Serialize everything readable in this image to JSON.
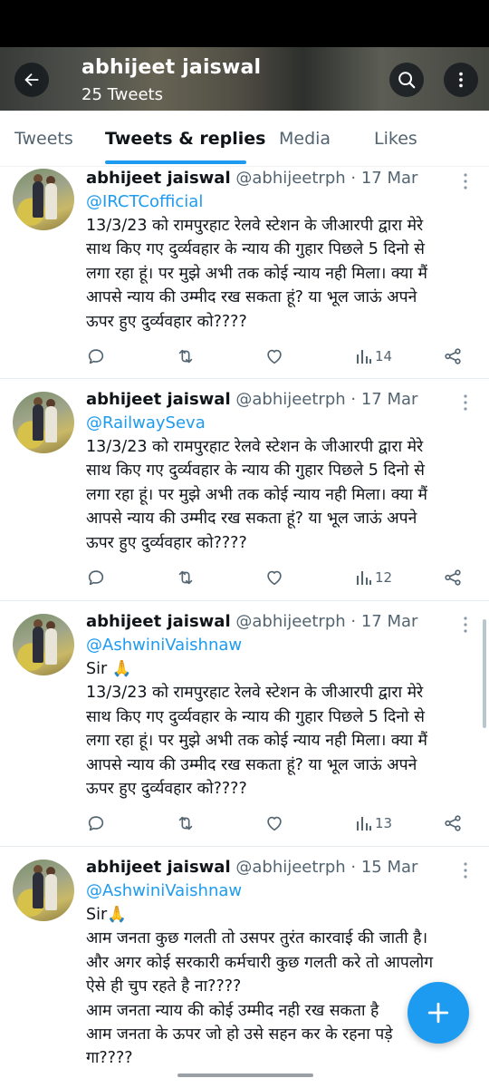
{
  "header": {
    "title": "abhijeet jaiswal",
    "subtitle": "25 Tweets",
    "back_icon": "arrow-left-icon",
    "search_icon": "search-icon",
    "more_icon": "more-vertical-icon"
  },
  "tabs": [
    {
      "label": "Tweets",
      "active": false
    },
    {
      "label": "Tweets & replies",
      "active": true
    },
    {
      "label": "Media",
      "active": false
    },
    {
      "label": "Likes",
      "active": false
    }
  ],
  "tweets": [
    {
      "name": "abhijeet jaiswal",
      "handle": "@abhijeetrph · 17 Mar",
      "mention": "@IRCTCofficial",
      "text": "13/3/23 को रामपुरहाट रेलवे स्टेशन के जीआरपी द्वारा मेरे\nसाथ किए गए दुर्व्यवहार के न्याय की गुहार पिछले 5 दिनो से\nलगा रहा हूं। पर मुझे अभी तक कोई न्याय नही मिला। क्या मैं\nआपसे न्याय की उम्मीद रख सकता हूं? या भूल जाऊं अपने\nऊपर हुए दुर्व्यवहार को????",
      "views": "14"
    },
    {
      "name": "abhijeet jaiswal",
      "handle": "@abhijeetrph · 17 Mar",
      "mention": "@RailwaySeva",
      "text": "13/3/23 को रामपुरहाट रेलवे स्टेशन के जीआरपी द्वारा मेरे\nसाथ किए गए दुर्व्यवहार के न्याय की गुहार पिछले 5 दिनो से\nलगा रहा हूं। पर मुझे अभी तक कोई न्याय नही मिला। क्या मैं\nआपसे न्याय की उम्मीद रख सकता हूं? या भूल जाऊं अपने\nऊपर हुए दुर्व्यवहार को????",
      "views": "12"
    },
    {
      "name": "abhijeet jaiswal",
      "handle": "@abhijeetrph · 17 Mar",
      "mention": "@AshwiniVaishnaw",
      "text": "Sir 🙏\n13/3/23 को रामपुरहाट रेलवे स्टेशन के जीआरपी द्वारा मेरे\nसाथ किए गए दुर्व्यवहार के न्याय की गुहार पिछले 5 दिनो से\nलगा रहा हूं। पर मुझे अभी तक कोई न्याय नही मिला। क्या मैं\nआपसे न्याय की उम्मीद रख सकता हूं? या भूल जाऊं अपने\nऊपर हुए दुर्व्यवहार को????",
      "views": "13"
    },
    {
      "name": "abhijeet jaiswal",
      "handle": "@abhijeetrph · 15 Mar",
      "mention": "@AshwiniVaishnaw",
      "text": "Sir🙏\nआम जनता कुछ गलती तो उसपर तुरंत कारवाई की जाती है।\nऔर अगर कोई सरकारी कर्मचारी कुछ गलती करे तो आपलोग\nऐसे ही चुप रहते है ना????\nआम जनता न्याय की कोई उम्मीद नही रख सकता है\nआम जनता के ऊपर जो हो उसे सहन कर के रहना पड़े\nगा????",
      "views": ""
    }
  ],
  "fab": {
    "icon": "plus-icon"
  },
  "colors": {
    "accent": "#1d9bf0",
    "text": "#0f1419",
    "muted": "#536471"
  }
}
